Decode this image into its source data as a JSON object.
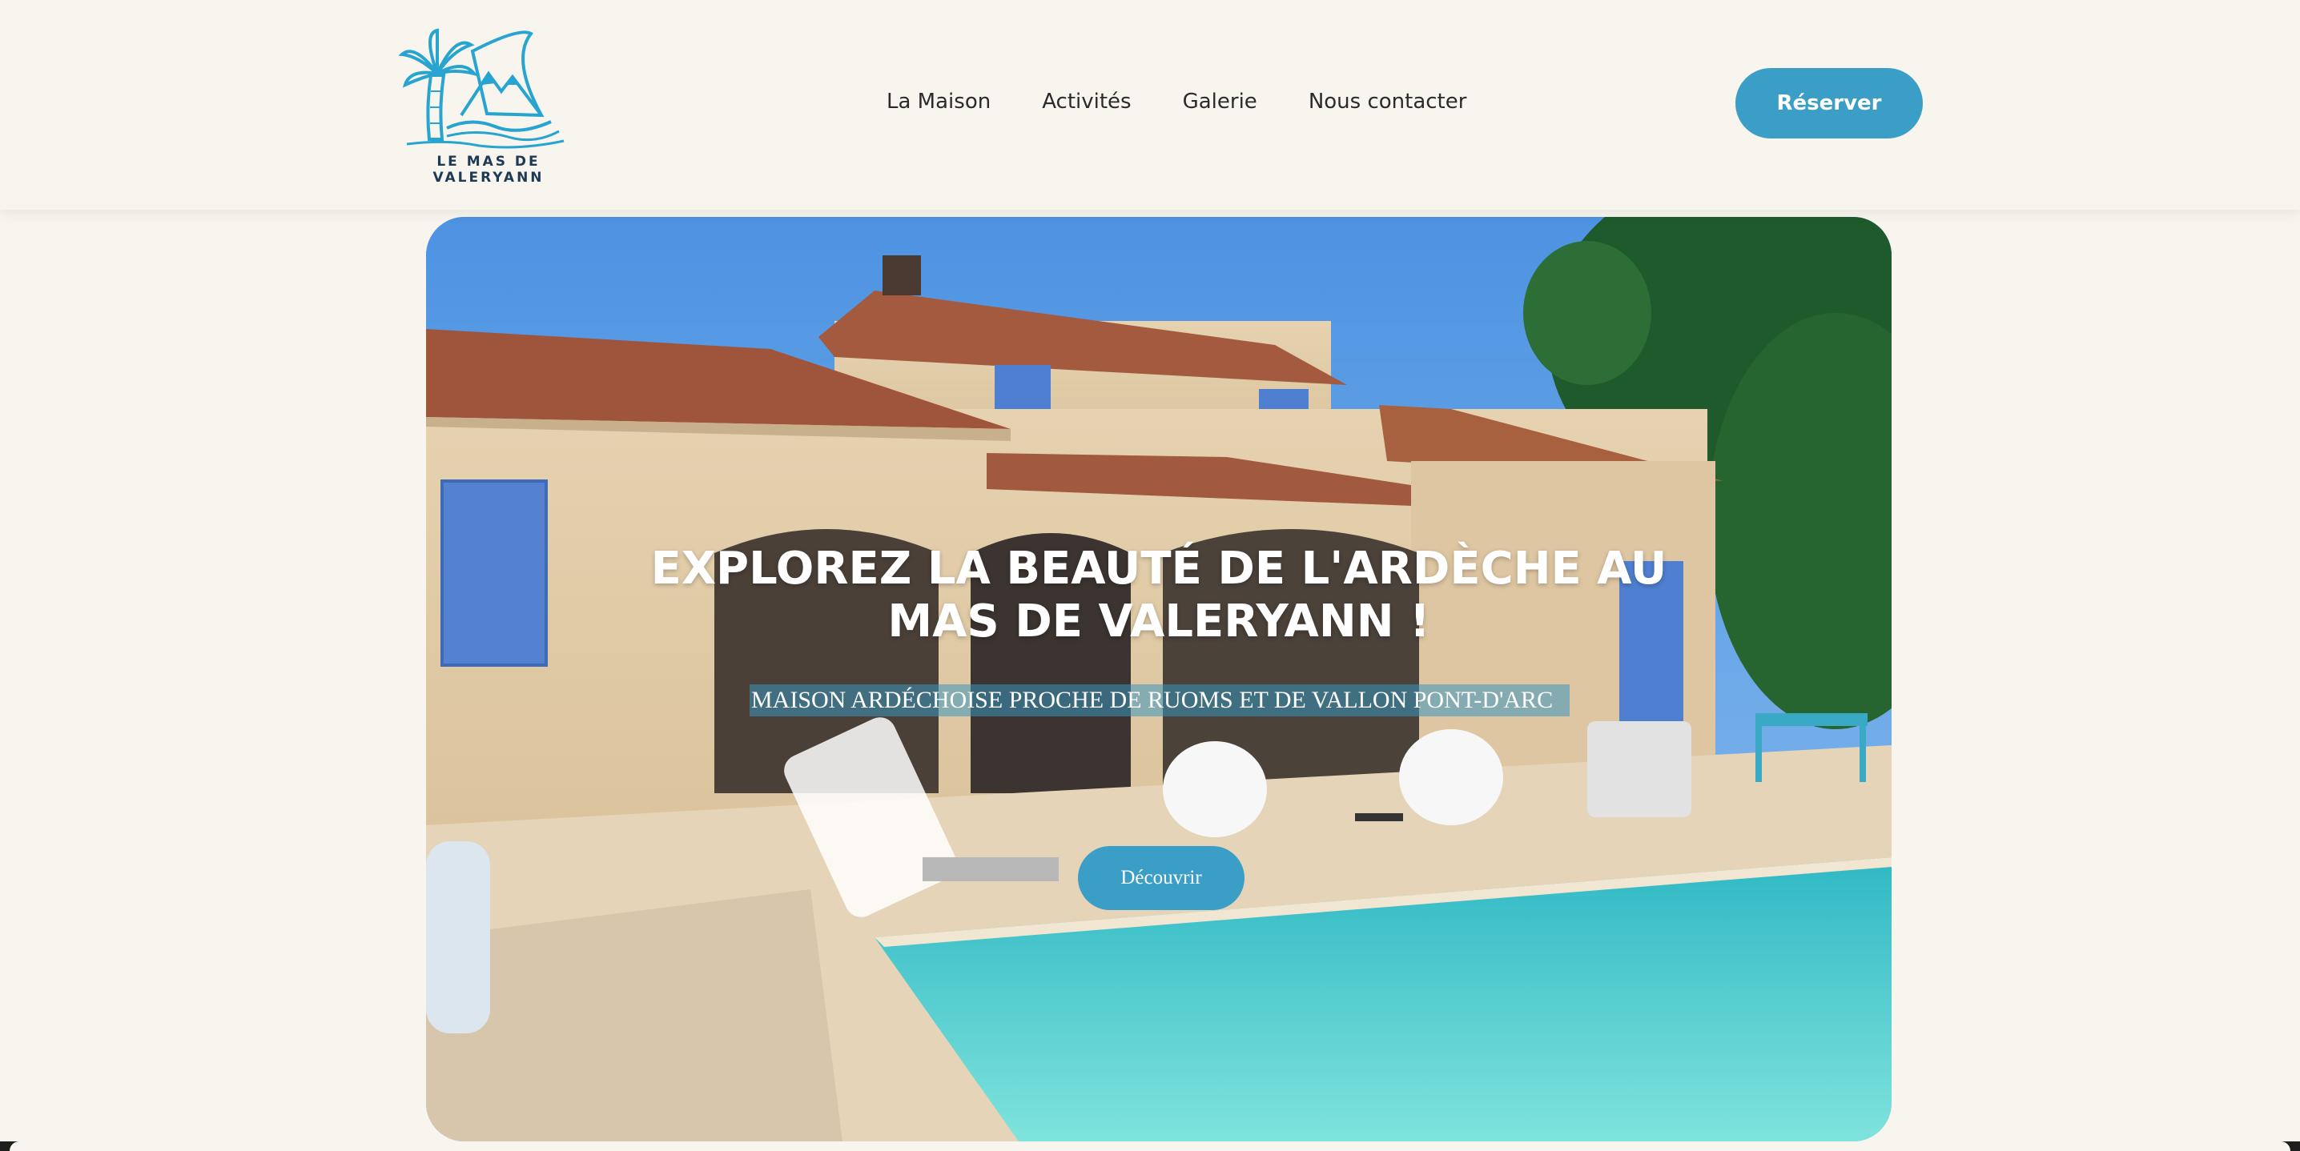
{
  "brand": {
    "name": "LE MAS DE VALERYANN",
    "logo_color": "#27a4cf",
    "text_color": "#1d3a55"
  },
  "nav": {
    "items": [
      {
        "label": "La Maison"
      },
      {
        "label": "Activités"
      },
      {
        "label": "Galerie"
      },
      {
        "label": "Nous contacter"
      }
    ]
  },
  "header": {
    "reserve_label": "Réserver"
  },
  "hero": {
    "title_line1": "EXPLOREZ LA BEAUTÉ DE L'ARDÈCHE AU",
    "title_line2": "MAS DE VALERYANN !",
    "subtitle": "MAISON ARDÉCHOISE PROCHE DE RUOMS ET DE VALLON PONT-D'ARC",
    "cta_label": "Découvrir"
  },
  "colors": {
    "background": "#f8f4ee",
    "accent": "#3a9ec6",
    "pool": "#5fd6d3",
    "sky": "#5da1e6"
  }
}
